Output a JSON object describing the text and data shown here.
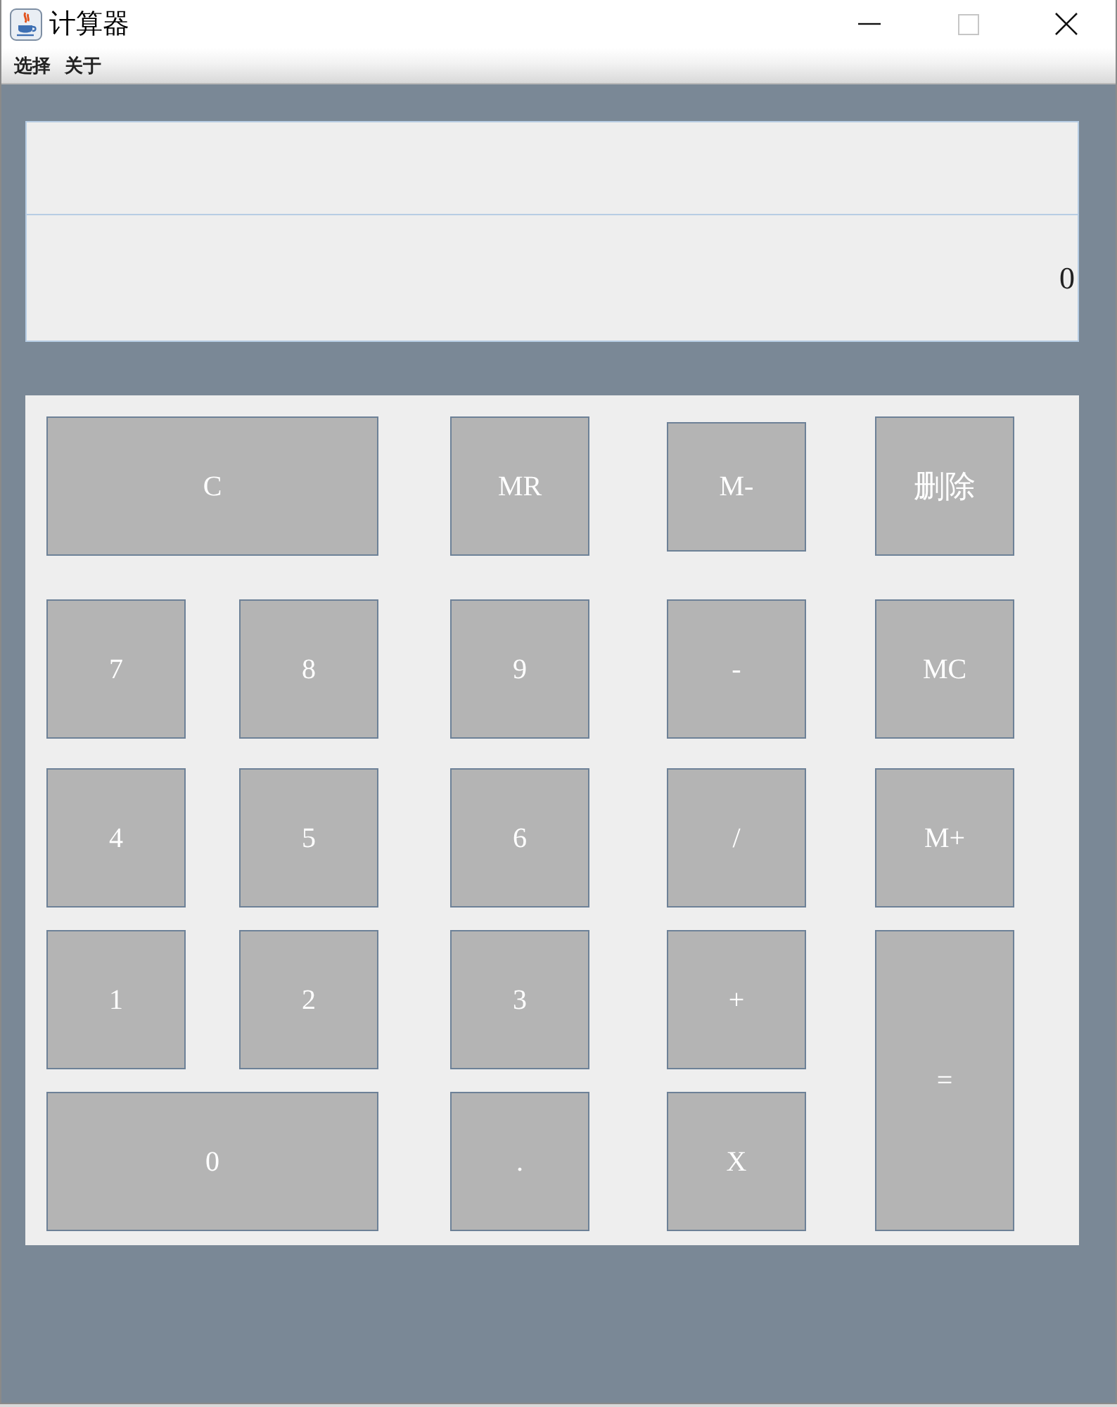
{
  "window": {
    "title": "计算器",
    "controls": [
      {
        "kind": "minimize",
        "disabled": false
      },
      {
        "kind": "maximize",
        "disabled": true
      },
      {
        "kind": "close",
        "disabled": false
      }
    ]
  },
  "menu": [
    "选择",
    "关于"
  ],
  "display": {
    "value": "0"
  },
  "keypad": {
    "keys": [
      "C",
      "MR",
      "M-",
      "删除",
      "7",
      "8",
      "9",
      "-",
      "MC",
      "4",
      "5",
      "6",
      "/",
      "M+",
      "1",
      "2",
      "3",
      "+",
      "=",
      "0",
      ".",
      "X"
    ]
  }
}
